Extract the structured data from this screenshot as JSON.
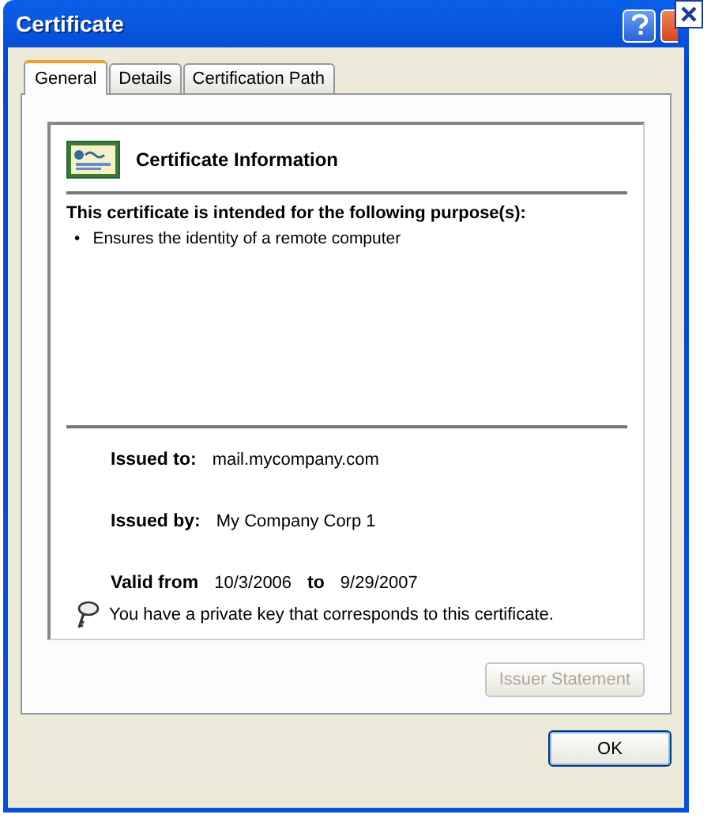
{
  "window": {
    "title": "Certificate"
  },
  "tabs": [
    {
      "label": "General",
      "selected": true
    },
    {
      "label": "Details",
      "selected": false
    },
    {
      "label": "Certification Path",
      "selected": false
    }
  ],
  "info": {
    "heading": "Certificate Information",
    "purpose_title": "This certificate is intended for the following purpose(s):",
    "purposes": [
      "Ensures the identity of a remote computer"
    ],
    "bullet": "•",
    "issued_to_label": "Issued to:",
    "issued_to": "mail.mycompany.com",
    "issued_by_label": "Issued by:",
    "issued_by": "My Company Corp 1",
    "valid_from_label": "Valid from",
    "valid_from": "10/3/2006",
    "valid_to_label": "to",
    "valid_to": "9/29/2007",
    "key_note": "You have a private key that corresponds to this certificate."
  },
  "issuer_button": {
    "label": "Issuer Statement",
    "disabled": true
  },
  "buttons": [
    "OK"
  ]
}
